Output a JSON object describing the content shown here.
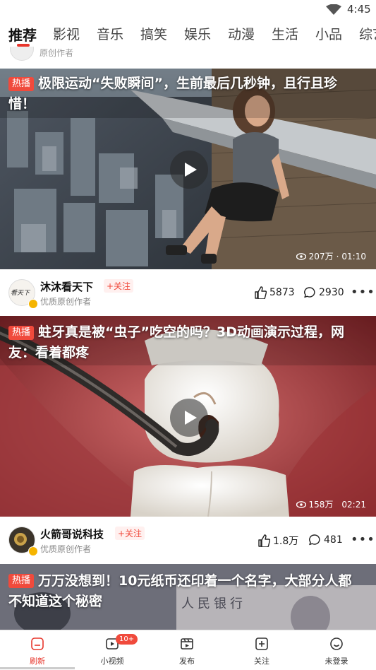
{
  "status_bar": {
    "time": "4:45"
  },
  "tabs": [
    "推荐",
    "影视",
    "音乐",
    "搞笑",
    "娱乐",
    "动漫",
    "生活",
    "小品",
    "综艺"
  ],
  "peek": {
    "text": "原创作者"
  },
  "cards": [
    {
      "hot_label": "热播",
      "title_line1": "极限运动“失败瞬间”，生前最后几秒钟，且行且珍",
      "title_line2": "惜！",
      "views": "207万",
      "duration": "01:10",
      "author": "沐沐看天下",
      "avatar_text": "看天下",
      "follow_label": "+关注",
      "author_sub": "优质原创作者",
      "likes": "5873",
      "comments": "2930"
    },
    {
      "hot_label": "热播",
      "title_line1": "蛀牙真是被“虫子”吃空的吗？3D动画演示过程，网",
      "title_line2": "友：看着都疼",
      "views": "158万",
      "duration": "02:21",
      "author": "火箭哥说科技",
      "follow_label": "+关注",
      "author_sub": "优质原创作者",
      "likes": "1.8万",
      "comments": "481"
    },
    {
      "hot_label": "热播",
      "title_line1": "万万没想到！10元纸币还印着一个名字，大部分人都",
      "title_line2": "不知道这个秘密",
      "banknote_text": "人民银行"
    }
  ],
  "bottom_nav": [
    {
      "label": "刷新",
      "icon": "refresh-icon"
    },
    {
      "label": "小视频",
      "icon": "small-video-icon",
      "badge": "10+"
    },
    {
      "label": "发布",
      "icon": "publish-icon"
    },
    {
      "label": "关注",
      "icon": "follow-icon"
    },
    {
      "label": "未登录",
      "icon": "user-icon"
    }
  ],
  "colors": {
    "accent": "#e8362c",
    "hot": "#f04a3c",
    "verified": "#f5b400"
  }
}
